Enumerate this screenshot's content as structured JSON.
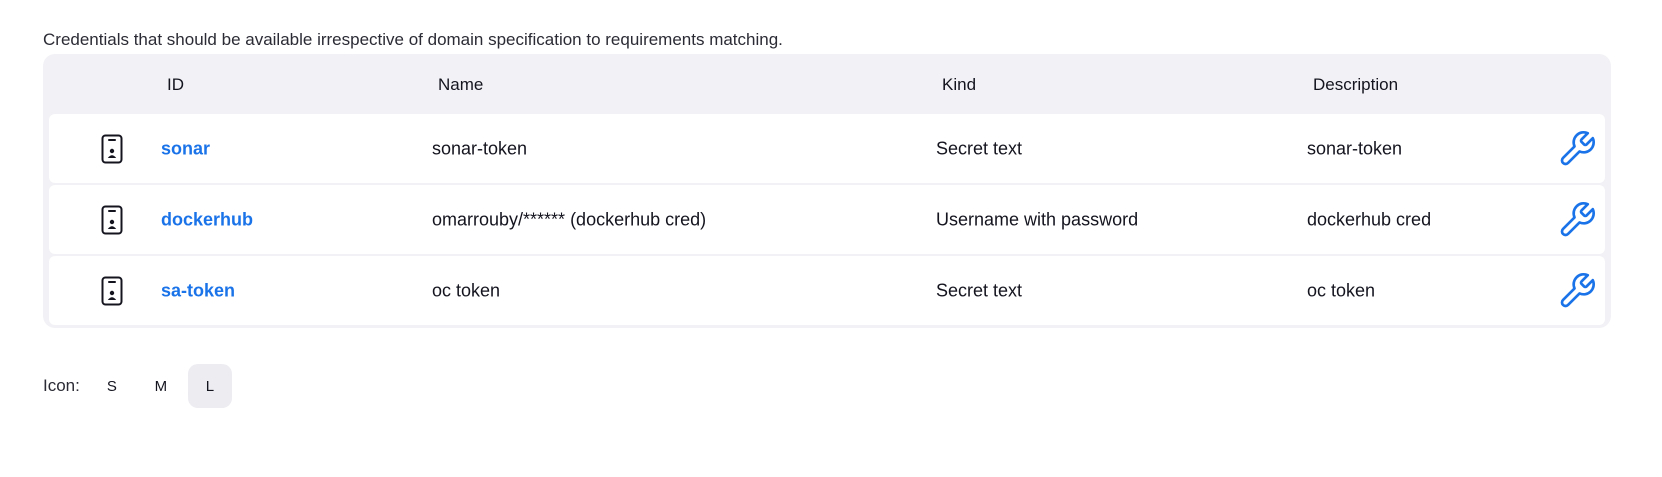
{
  "description": "Credentials that should be available irrespective of domain specification to requirements matching.",
  "table": {
    "headers": {
      "id": "ID",
      "name": "Name",
      "kind": "Kind",
      "description": "Description"
    },
    "rows": [
      {
        "icon": "credential-card-icon",
        "id": "sonar",
        "name": "sonar-token",
        "kind": "Secret text",
        "description": "sonar-token",
        "action_icon": "wrench-icon"
      },
      {
        "icon": "credential-card-icon",
        "id": "dockerhub",
        "name": "omarrouby/****** (dockerhub cred)",
        "kind": "Username with password",
        "description": "dockerhub cred",
        "action_icon": "wrench-icon"
      },
      {
        "icon": "credential-card-icon",
        "id": "sa-token",
        "name": "oc token",
        "kind": "Secret text",
        "description": "oc token",
        "action_icon": "wrench-icon"
      }
    ]
  },
  "icon_size": {
    "label": "Icon:",
    "options": [
      "S",
      "M",
      "L"
    ],
    "selected": "L"
  },
  "colors": {
    "link": "#1a73e8",
    "table_bg": "#f2f2f6",
    "row_bg": "#ffffff",
    "selected_size_bg": "#ececf1"
  }
}
